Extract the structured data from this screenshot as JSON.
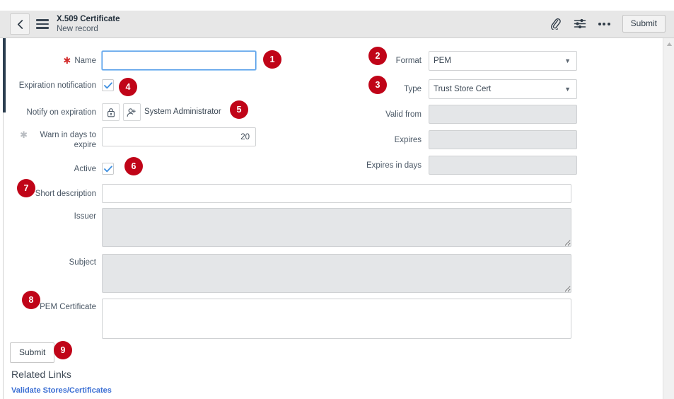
{
  "header": {
    "back_icon": "chevron-left-icon",
    "menu_icon": "hamburger-menu-icon",
    "title": "X.509 Certificate",
    "subtitle": "New record",
    "attachment_icon": "paperclip-icon",
    "personalize_icon": "sliders-icon",
    "more_icon": "more-options-icon",
    "submit_label": "Submit"
  },
  "form": {
    "name": {
      "label": "Name",
      "value": "",
      "placeholder": "",
      "required": true
    },
    "expiration_notification": {
      "label": "Expiration notification",
      "checked": true
    },
    "notify_on_expiration": {
      "label": "Notify on expiration",
      "lock_icon": "lock-icon",
      "user_icon": "add-user-icon",
      "value": "System Administrator"
    },
    "warn_days": {
      "label": "Warn in days to expire",
      "value": "20",
      "required": true
    },
    "active": {
      "label": "Active",
      "checked": true
    },
    "format": {
      "label": "Format",
      "value": "PEM",
      "options": [
        "PEM"
      ]
    },
    "type": {
      "label": "Type",
      "value": "Trust Store Cert",
      "options": [
        "Trust Store Cert"
      ]
    },
    "valid_from": {
      "label": "Valid from",
      "value": "",
      "readonly": true
    },
    "expires": {
      "label": "Expires",
      "value": "",
      "readonly": true
    },
    "expires_in_days": {
      "label": "Expires in days",
      "value": "",
      "readonly": true
    },
    "short_description": {
      "label": "Short description",
      "value": ""
    },
    "issuer": {
      "label": "Issuer",
      "value": "",
      "readonly": true
    },
    "subject": {
      "label": "Subject",
      "value": "",
      "readonly": true
    },
    "pem_certificate": {
      "label": "PEM Certificate",
      "value": ""
    }
  },
  "footer": {
    "submit_label": "Submit",
    "related_links_title": "Related Links",
    "related_link_1": "Validate Stores/Certificates"
  },
  "badges": [
    {
      "num": "1"
    },
    {
      "num": "2"
    },
    {
      "num": "3"
    },
    {
      "num": "4"
    },
    {
      "num": "5"
    },
    {
      "num": "6"
    },
    {
      "num": "7"
    },
    {
      "num": "8"
    },
    {
      "num": "9"
    }
  ],
  "colors": {
    "badge_red": "#c00418",
    "header_bg": "#e7e7e7",
    "rail": "#2c3e50",
    "link": "#3b6fd4",
    "focus_border": "#4f9ae8",
    "required_star": "#d32b2b",
    "readonly_bg": "#e4e6e8"
  }
}
